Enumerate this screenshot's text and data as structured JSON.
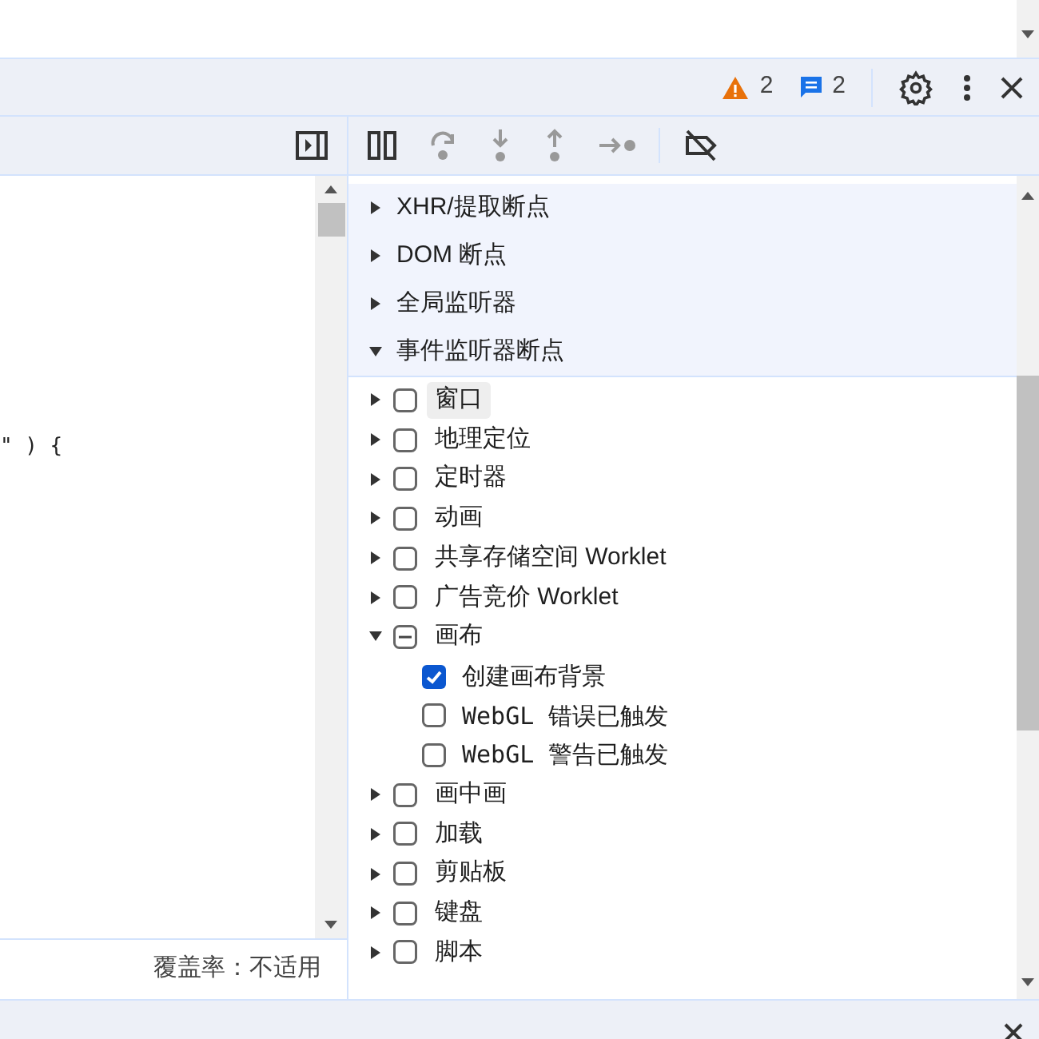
{
  "toolbar": {
    "warnings": "2",
    "messages": "2"
  },
  "code": {
    "text": "\" ) {"
  },
  "coverage": "覆盖率：不适用",
  "sections": [
    {
      "label": "XHR/提取断点",
      "expanded": false
    },
    {
      "label": "DOM 断点",
      "expanded": false
    },
    {
      "label": "全局监听器",
      "expanded": false
    },
    {
      "label": "事件监听器断点",
      "expanded": true
    }
  ],
  "listeners": [
    {
      "label": "窗口",
      "expanded": false,
      "checked": false,
      "mixed": false,
      "hovered": true
    },
    {
      "label": "地理定位",
      "expanded": false,
      "checked": false,
      "mixed": false,
      "hovered": false
    },
    {
      "label": "定时器",
      "expanded": false,
      "checked": false,
      "mixed": false,
      "hovered": false
    },
    {
      "label": "动画",
      "expanded": false,
      "checked": false,
      "mixed": false,
      "hovered": false
    },
    {
      "label": "共享存储空间 Worklet",
      "expanded": false,
      "checked": false,
      "mixed": false,
      "hovered": false
    },
    {
      "label": "广告竞价 Worklet",
      "expanded": false,
      "checked": false,
      "mixed": false,
      "hovered": false
    },
    {
      "label": "画布",
      "expanded": true,
      "checked": false,
      "mixed": true,
      "hovered": false,
      "children": [
        {
          "label": "创建画布背景",
          "checked": true
        },
        {
          "label": "WebGL 错误已触发",
          "checked": false
        },
        {
          "label": "WebGL 警告已触发",
          "checked": false
        }
      ]
    },
    {
      "label": "画中画",
      "expanded": false,
      "checked": false,
      "mixed": false,
      "hovered": false
    },
    {
      "label": "加载",
      "expanded": false,
      "checked": false,
      "mixed": false,
      "hovered": false
    },
    {
      "label": "剪贴板",
      "expanded": false,
      "checked": false,
      "mixed": false,
      "hovered": false
    },
    {
      "label": "键盘",
      "expanded": false,
      "checked": false,
      "mixed": false,
      "hovered": false
    },
    {
      "label": "脚本",
      "expanded": false,
      "checked": false,
      "mixed": false,
      "hovered": false
    }
  ]
}
